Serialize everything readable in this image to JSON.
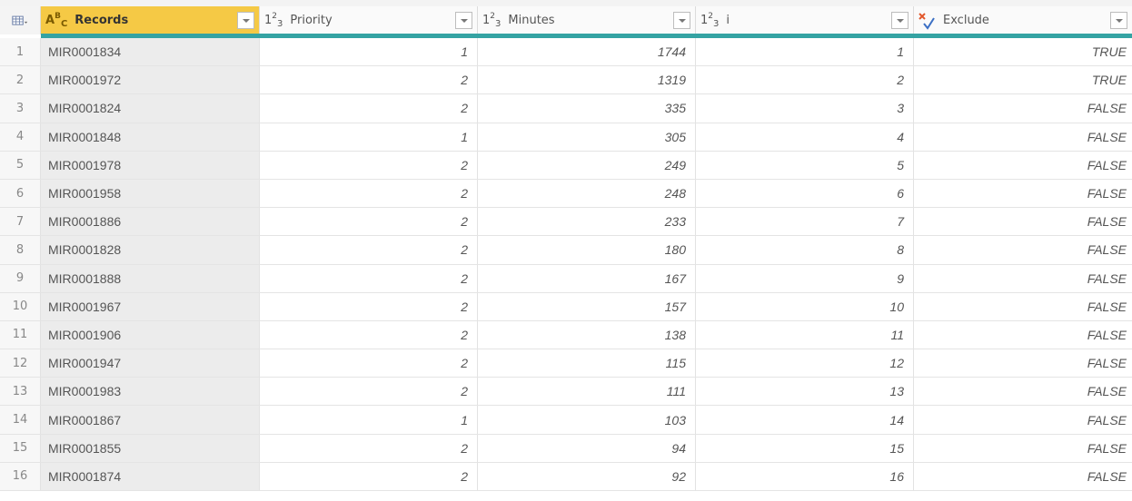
{
  "table": {
    "columns": [
      {
        "name": "Records",
        "type_icon": "text-type-icon",
        "type_label": [
          "A",
          "B",
          "C"
        ]
      },
      {
        "name": "Priority",
        "type_icon": "whole-number-type-icon",
        "type_label": [
          "1",
          "2",
          "3"
        ]
      },
      {
        "name": "Minutes",
        "type_icon": "whole-number-type-icon",
        "type_label": [
          "1",
          "2",
          "3"
        ]
      },
      {
        "name": "i",
        "type_icon": "whole-number-type-icon",
        "type_label": [
          "1",
          "2",
          "3"
        ]
      },
      {
        "name": "Exclude",
        "type_icon": "logical-type-icon",
        "type_label": []
      }
    ],
    "rows": [
      {
        "n": "1",
        "records": "MIR0001834",
        "priority": "1",
        "minutes": "1744",
        "i": "1",
        "exclude": "TRUE"
      },
      {
        "n": "2",
        "records": "MIR0001972",
        "priority": "2",
        "minutes": "1319",
        "i": "2",
        "exclude": "TRUE"
      },
      {
        "n": "3",
        "records": "MIR0001824",
        "priority": "2",
        "minutes": "335",
        "i": "3",
        "exclude": "FALSE"
      },
      {
        "n": "4",
        "records": "MIR0001848",
        "priority": "1",
        "minutes": "305",
        "i": "4",
        "exclude": "FALSE"
      },
      {
        "n": "5",
        "records": "MIR0001978",
        "priority": "2",
        "minutes": "249",
        "i": "5",
        "exclude": "FALSE"
      },
      {
        "n": "6",
        "records": "MIR0001958",
        "priority": "2",
        "minutes": "248",
        "i": "6",
        "exclude": "FALSE"
      },
      {
        "n": "7",
        "records": "MIR0001886",
        "priority": "2",
        "minutes": "233",
        "i": "7",
        "exclude": "FALSE"
      },
      {
        "n": "8",
        "records": "MIR0001828",
        "priority": "2",
        "minutes": "180",
        "i": "8",
        "exclude": "FALSE"
      },
      {
        "n": "9",
        "records": "MIR0001888",
        "priority": "2",
        "minutes": "167",
        "i": "9",
        "exclude": "FALSE"
      },
      {
        "n": "10",
        "records": "MIR0001967",
        "priority": "2",
        "minutes": "157",
        "i": "10",
        "exclude": "FALSE"
      },
      {
        "n": "11",
        "records": "MIR0001906",
        "priority": "2",
        "minutes": "138",
        "i": "11",
        "exclude": "FALSE"
      },
      {
        "n": "12",
        "records": "MIR0001947",
        "priority": "2",
        "minutes": "115",
        "i": "12",
        "exclude": "FALSE"
      },
      {
        "n": "13",
        "records": "MIR0001983",
        "priority": "2",
        "minutes": "111",
        "i": "13",
        "exclude": "FALSE"
      },
      {
        "n": "14",
        "records": "MIR0001867",
        "priority": "1",
        "minutes": "103",
        "i": "14",
        "exclude": "FALSE"
      },
      {
        "n": "15",
        "records": "MIR0001855",
        "priority": "2",
        "minutes": "94",
        "i": "15",
        "exclude": "FALSE"
      },
      {
        "n": "16",
        "records": "MIR0001874",
        "priority": "2",
        "minutes": "92",
        "i": "16",
        "exclude": "FALSE"
      }
    ]
  },
  "colors": {
    "selected_column_header": "#f5c945",
    "column_quality_bar": "#34a3a3",
    "selected_column_cells": "#ececec"
  }
}
